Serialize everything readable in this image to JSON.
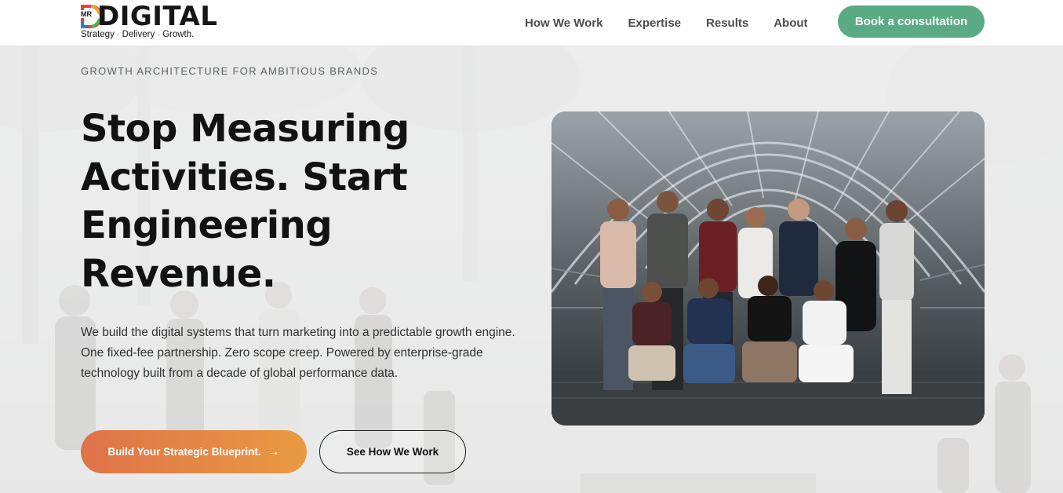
{
  "brand": {
    "logo_prefix": "MR",
    "logo_word": "DIGITAL",
    "tagline_parts": [
      "Strategy",
      "Delivery",
      "Growth."
    ],
    "colors": {
      "red": "#e0453b",
      "orange": "#f0a030",
      "green": "#4caf50",
      "blue": "#2b7bd6"
    }
  },
  "nav": {
    "items": [
      {
        "label": "How We Work"
      },
      {
        "label": "Expertise"
      },
      {
        "label": "Results"
      },
      {
        "label": "About"
      }
    ],
    "cta_label": "Book a consultation",
    "cta_color": "#5aab83"
  },
  "hero": {
    "eyebrow": "GROWTH ARCHITECTURE FOR AMBITIOUS BRANDS",
    "headline": "Stop Measuring Activities. Start Engineering Revenue.",
    "description": "We build the digital systems that turn marketing into a predictable growth engine. One fixed-fee partnership. Zero scope creep. Powered by enterprise-grade technology built from a decade of global performance data.",
    "primary_cta": {
      "label": "Build Your Strategic Blueprint.",
      "icon": "arrow-right-icon",
      "gradient": [
        "#df7249",
        "#e99a42"
      ]
    },
    "secondary_cta": {
      "label": "See How We Work"
    },
    "image": {
      "subject": "team-group-photo"
    }
  }
}
